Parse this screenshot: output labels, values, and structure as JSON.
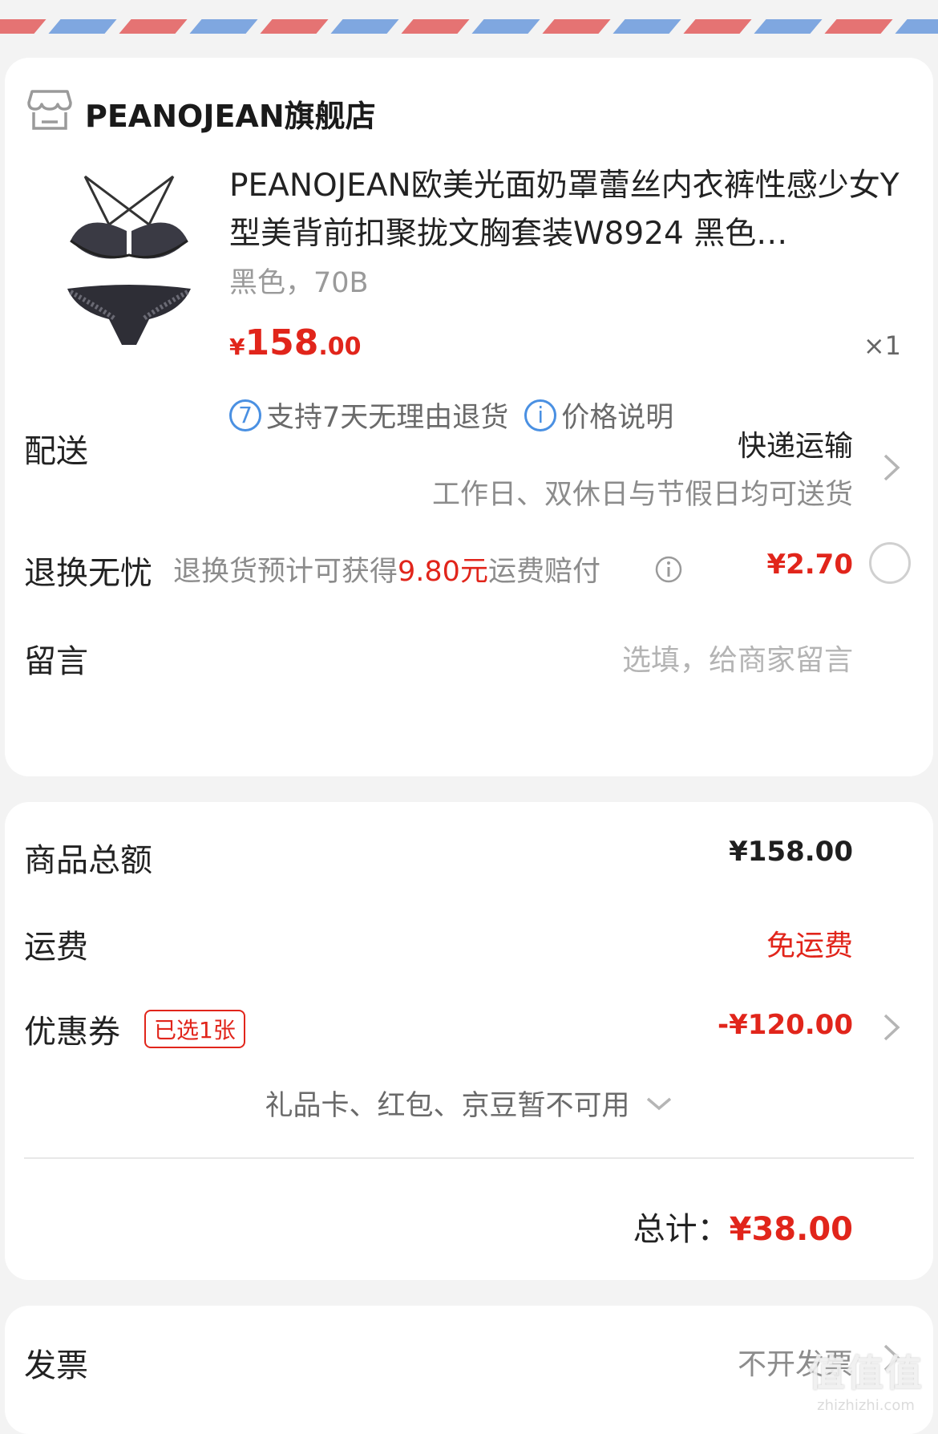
{
  "shop": {
    "name": "PEANOJEAN旗舰店",
    "icon": "store-icon"
  },
  "product": {
    "title": "PEANOJEAN欧美光面奶罩蕾丝内衣裤性感少女Y型美背前扣聚拢文胸套装W8924 黑色…",
    "variant": "黑色，70B",
    "price_symbol": "¥",
    "price_int": "158",
    "price_dec": ".00",
    "quantity": "×1",
    "return_badge_num": "7",
    "return_badge_text": "支持7天无理由退货",
    "price_info_icon": "i",
    "price_info_text": "价格说明"
  },
  "delivery": {
    "label": "配送",
    "method": "快递运输",
    "note": "工作日、双休日与节假日均可送货"
  },
  "return_insurance": {
    "label": "退换无忧",
    "desc_prefix": "退换货预计可获得",
    "desc_amount": "9.80元",
    "desc_suffix": "运费赔付",
    "price": "¥2.70"
  },
  "message": {
    "label": "留言",
    "placeholder": "选填，给商家留言"
  },
  "summary": {
    "goods_total_label": "商品总额",
    "goods_total_value": "¥158.00",
    "shipping_label": "运费",
    "shipping_value": "免运费",
    "coupon_label": "优惠券",
    "coupon_tag": "已选1张",
    "coupon_value": "-¥120.00",
    "unavailable": "礼品卡、红包、京豆暂不可用",
    "total_label": "总计：",
    "total_value": "¥38.00"
  },
  "invoice": {
    "label": "发票",
    "value": "不开发票"
  },
  "watermark": {
    "brand": "值值值",
    "url": "zhizhizhi.com"
  },
  "colors": {
    "accent": "#e1251b",
    "blue": "#4a90e2",
    "stripe_red": "#e57373",
    "stripe_blue": "#7fa7e0"
  }
}
